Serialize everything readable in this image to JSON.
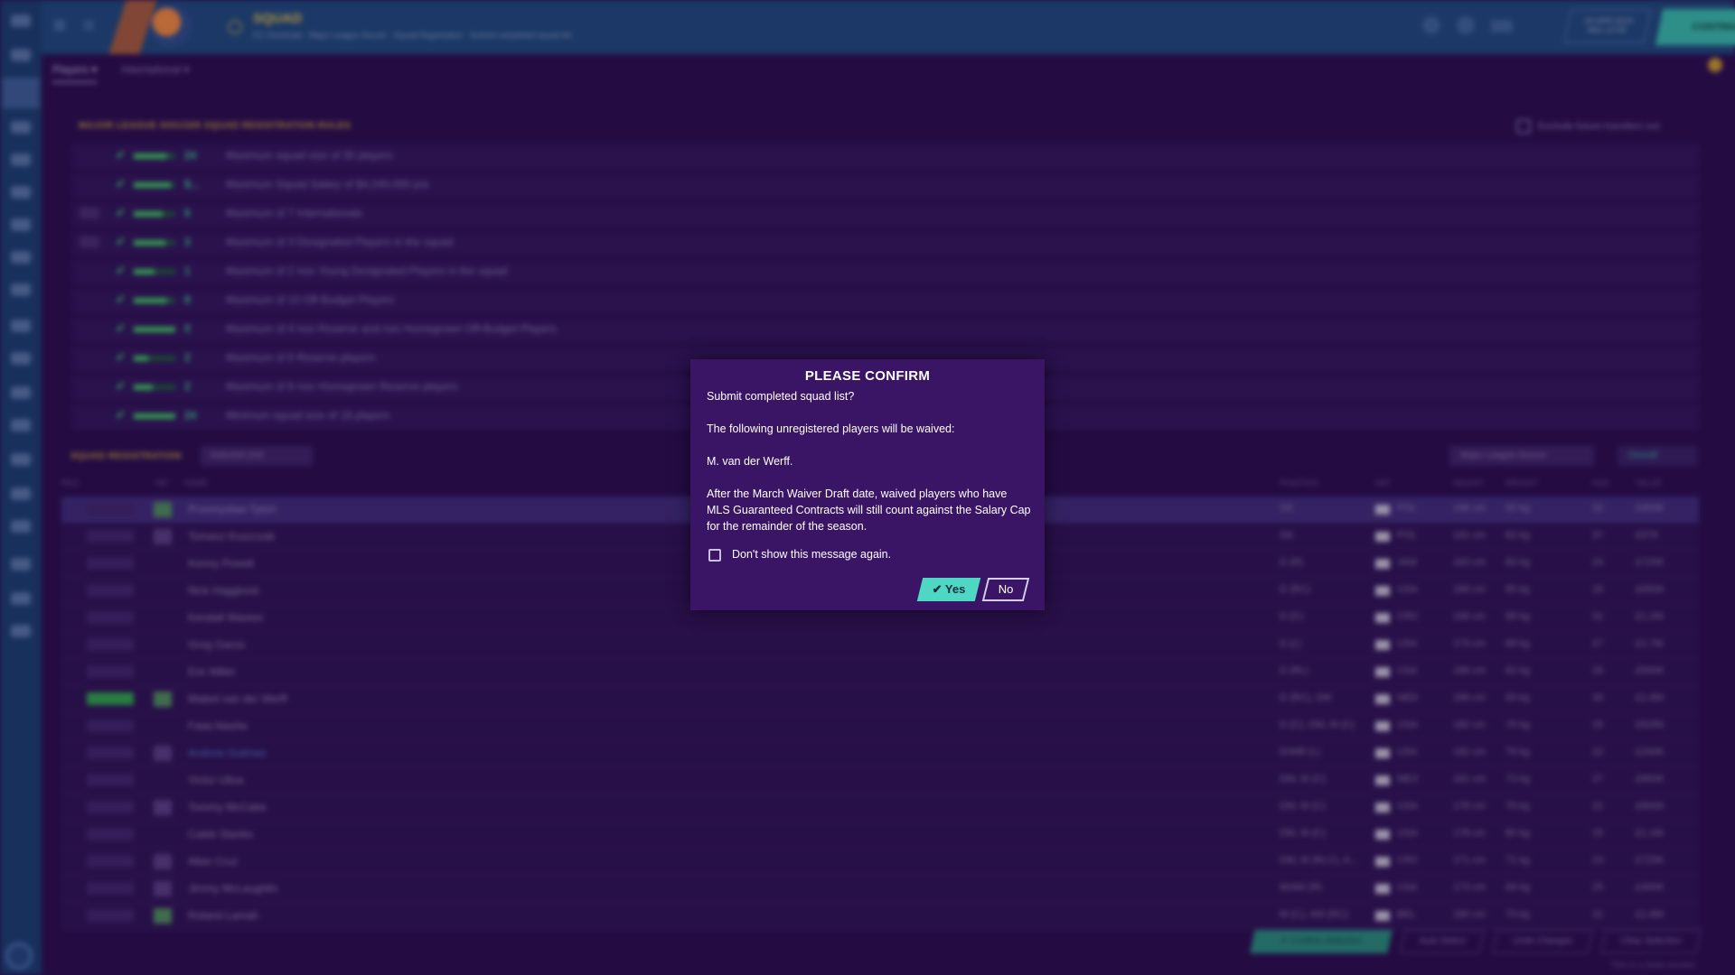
{
  "topbar": {
    "title": "SQUAD",
    "subtitle": "FC Cincinnati · Major League Soccer · Squad Registration · Submit completed squad list",
    "date": "04 APR 2019",
    "date_sub": "Mon 12:00",
    "continue_label": "CONTINUE",
    "bg_color": "#1e4a7b",
    "accent_color": "#37bda9"
  },
  "tabs": [
    {
      "label": "Players ▾"
    },
    {
      "label": "International ▾"
    }
  ],
  "rules": {
    "title": "MAJOR LEAGUE SOCCER SQUAD REGISTRATION RULES",
    "exclude_label": "Exclude future transfers out",
    "items": [
      {
        "count": "24",
        "text": "Maximum squad size of 30 players",
        "fill": 0.8
      },
      {
        "count": "$...",
        "text": "Maximum Squad Salary of $4,240,000 p/a",
        "fill": 0.9
      },
      {
        "count": "5",
        "text": "Maximum of 7 Internationals",
        "fill": 0.7
      },
      {
        "count": "3",
        "text": "Maximum of 3 Designated Players in the squad",
        "fill": 0.75
      },
      {
        "count": "1",
        "text": "Maximum of 2 non Young Designated Players in the squad",
        "fill": 0.5
      },
      {
        "count": "8",
        "text": "Maximum of 10 Off-Budget Players",
        "fill": 0.8
      },
      {
        "count": "0",
        "text": "Maximum of 4 non Reserve and non Homegrown Off-Budget Players",
        "fill": 1.0
      },
      {
        "count": "2",
        "text": "Maximum of 6 Reserve players",
        "fill": 0.35
      },
      {
        "count": "2",
        "text": "Maximum of 6 non Homegrown Reserve players",
        "fill": 0.45
      },
      {
        "count": "24",
        "text": "Minimum squad size of 18 players",
        "fill": 1.0
      }
    ]
  },
  "squad": {
    "title": "SQUAD REGISTRATION",
    "filter_label": "Selected (24)",
    "league_label": "Major League Soccer",
    "view_label": "Overall",
    "headers": [
      "REG",
      "INF",
      "NAME",
      "POSITION",
      "NAT",
      "HEIGHT",
      "WEIGHT",
      "AGE",
      "VALUE"
    ],
    "players": [
      {
        "name": "Przemysław Tytoń",
        "pos": "GK",
        "nat": "POL",
        "height": "196 cm",
        "weight": "92 kg",
        "age": "32",
        "value": "£400K"
      },
      {
        "name": "Tomasz Kuszczak",
        "pos": "GK",
        "nat": "POL",
        "height": "191 cm",
        "weight": "82 kg",
        "age": "37",
        "value": "£97K"
      },
      {
        "name": "Kenny Powell",
        "pos": "D (R)",
        "nat": "JAM",
        "height": "183 cm",
        "weight": "80 kg",
        "age": "24",
        "value": "£725K"
      },
      {
        "name": "Nick Hagglund",
        "pos": "D (RC)",
        "nat": "USA",
        "height": "188 cm",
        "weight": "85 kg",
        "age": "26",
        "value": "£650K"
      },
      {
        "name": "Kendall Waston",
        "pos": "D (C)",
        "nat": "CRC",
        "height": "196 cm",
        "weight": "88 kg",
        "age": "31",
        "value": "£1.2M"
      },
      {
        "name": "Greg Garza",
        "pos": "D (L)",
        "nat": "USA",
        "height": "173 cm",
        "weight": "68 kg",
        "age": "27",
        "value": "£1.7M"
      },
      {
        "name": "Eric Miller",
        "pos": "D (RL)",
        "nat": "USA",
        "height": "186 cm",
        "weight": "82 kg",
        "age": "26",
        "value": "£500K"
      },
      {
        "name": "Maikel van der Werff",
        "pos": "D (RC), DM",
        "nat": "NED",
        "height": "186 cm",
        "weight": "83 kg",
        "age": "30",
        "value": "£1.6M"
      },
      {
        "name": "Fatai Alashe",
        "pos": "D (C), DM, M (C)",
        "nat": "USA",
        "height": "182 cm",
        "weight": "79 kg",
        "age": "25",
        "value": "£525K"
      },
      {
        "name": "Andrew Gutman",
        "pos": "D/WB (L)",
        "nat": "USA",
        "height": "182 cm",
        "weight": "79 kg",
        "age": "22",
        "value": "£240K"
      },
      {
        "name": "Victor Ulloa",
        "pos": "DM, M (C)",
        "nat": "MEX",
        "height": "181 cm",
        "weight": "73 kg",
        "age": "27",
        "value": "£850K"
      },
      {
        "name": "Tommy McCabe",
        "pos": "DM, M (C)",
        "nat": "USA",
        "height": "178 cm",
        "weight": "78 kg",
        "age": "21",
        "value": "£800K"
      },
      {
        "name": "Caleb Stanko",
        "pos": "DM, M (C)",
        "nat": "USA",
        "height": "178 cm",
        "weight": "80 kg",
        "age": "25",
        "value": "£1.1M"
      },
      {
        "name": "Allan Cruz",
        "pos": "DM, M (RLC), A...",
        "nat": "CRC",
        "height": "171 cm",
        "weight": "71 kg",
        "age": "23",
        "value": "£725K"
      },
      {
        "name": "Jimmy McLaughlin",
        "pos": "M/AM (R)",
        "nat": "USA",
        "height": "173 cm",
        "weight": "68 kg",
        "age": "25",
        "value": "£400K"
      },
      {
        "name": "Roland Lamah",
        "pos": "M (C), AM (RC)",
        "nat": "BEL",
        "height": "180 cm",
        "weight": "70 kg",
        "age": "31",
        "value": "£1.8M"
      }
    ],
    "actions": [
      "✔ Confirm Selection",
      "Auto Select",
      "Undo Changes",
      "Clear Selection"
    ],
    "beta_note": "This is a beta version"
  },
  "dialog": {
    "title": "PLEASE CONFIRM",
    "line1": "Submit completed squad list?",
    "line2": "The following unregistered players will be waived:",
    "line3": "M. van der Werff.",
    "line4": "After the March Waiver Draft date, waived players who have MLS Guaranteed Contracts will still count against the Salary Cap for the remainder of the season.",
    "checkbox_label": "Don't show this message again.",
    "yes_label": "Yes",
    "no_label": "No",
    "bg_color": "#3a1566",
    "yes_color": "#4ed8c4"
  }
}
